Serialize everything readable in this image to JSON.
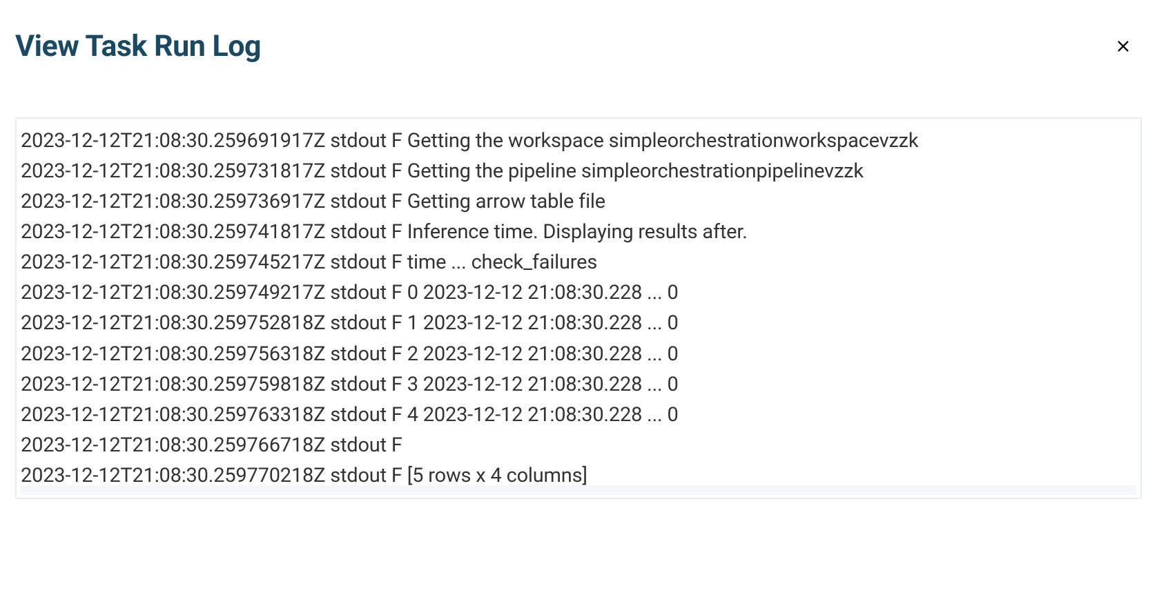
{
  "header": {
    "title": "View Task Run Log"
  },
  "log": {
    "lines": [
      "2023-12-12T21:08:30.259691917Z stdout F Getting the workspace simpleorchestrationworkspacevzzk",
      "2023-12-12T21:08:30.259731817Z stdout F Getting the pipeline simpleorchestrationpipelinevzzk",
      "2023-12-12T21:08:30.259736917Z stdout F Getting arrow table file",
      "2023-12-12T21:08:30.259741817Z stdout F Inference time. Displaying results after.",
      "2023-12-12T21:08:30.259745217Z stdout F time ... check_failures",
      "2023-12-12T21:08:30.259749217Z stdout F 0 2023-12-12 21:08:30.228 ... 0",
      "2023-12-12T21:08:30.259752818Z stdout F 1 2023-12-12 21:08:30.228 ... 0",
      "2023-12-12T21:08:30.259756318Z stdout F 2 2023-12-12 21:08:30.228 ... 0",
      "2023-12-12T21:08:30.259759818Z stdout F 3 2023-12-12 21:08:30.228 ... 0",
      "2023-12-12T21:08:30.259763318Z stdout F 4 2023-12-12 21:08:30.228 ... 0",
      "2023-12-12T21:08:30.259766718Z stdout F",
      "2023-12-12T21:08:30.259770218Z stdout F [5 rows x 4 columns]"
    ]
  }
}
